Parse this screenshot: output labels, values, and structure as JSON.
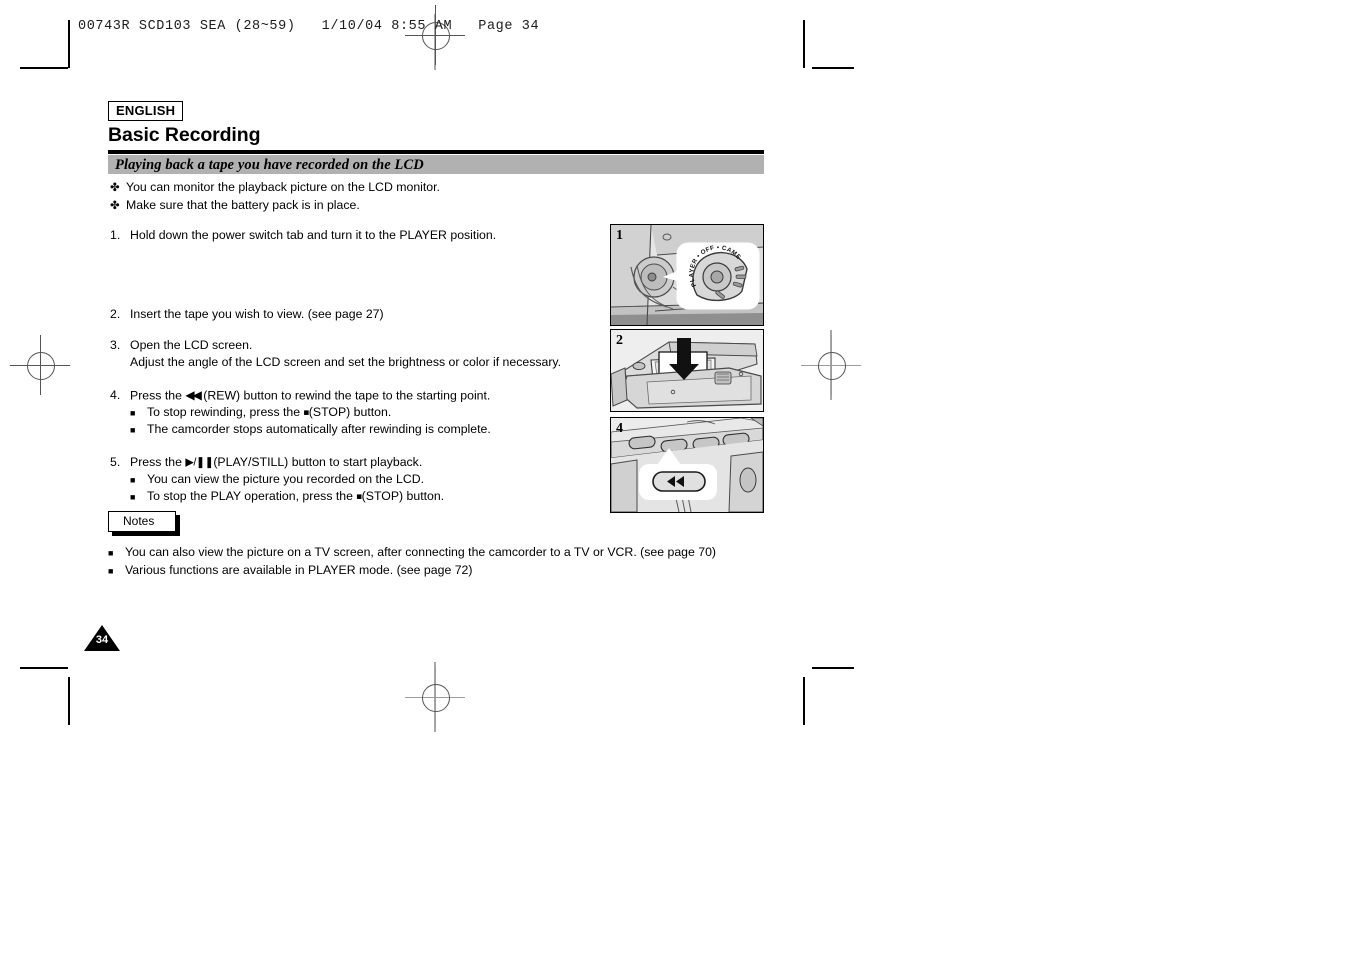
{
  "film_header": {
    "text": "00743R SCD103 SEA (28~59)   1/10/04 8:55 AM   Page 34"
  },
  "page": {
    "language_badge": "ENGLISH",
    "chapter_title": "Basic Recording",
    "section_title": "Playing back a tape you have recorded on the LCD",
    "page_number": "34"
  },
  "intro": {
    "bullet_glyph": "✤",
    "lines": [
      "You can monitor the playback picture on the LCD monitor.",
      "Make sure that the battery pack is in place."
    ]
  },
  "steps": [
    {
      "number": "1.",
      "text": "Hold down the power switch tab and turn it to the PLAYER position.",
      "continuation": "",
      "subs": []
    },
    {
      "number": "2.",
      "text": "Insert the tape you wish to view. (see page 27)",
      "continuation": "",
      "subs": []
    },
    {
      "number": "3.",
      "text": "Open the LCD screen.",
      "continuation": "Adjust the angle of the LCD screen and set the brightness or color if necessary.",
      "subs": []
    },
    {
      "number": "4.",
      "text_before": "Press the",
      "glyph": "◀◀",
      "text_after": "(REW) button to rewind the tape to the starting point.",
      "subs": [
        {
          "before": "To stop rewinding, press the",
          "glyph": "■",
          "after": "(STOP) button."
        },
        {
          "before": "The camcorder stops automatically after rewinding is complete.",
          "glyph": "",
          "after": ""
        }
      ]
    },
    {
      "number": "5.",
      "text_before": "Press the",
      "glyph": "▶/❚❚",
      "text_after": "(PLAY/STILL) button to start playback.",
      "subs": [
        {
          "before": "You can view the picture you recorded on the LCD.",
          "glyph": "",
          "after": ""
        },
        {
          "before": "To stop the PLAY operation, press the",
          "glyph": "■",
          "after": "(STOP) button."
        }
      ]
    }
  ],
  "notes": {
    "label": "Notes",
    "bullet_glyph": "■",
    "items": [
      "You can also view the picture on a TV screen, after connecting the camcorder to a TV or VCR. (see page 70)",
      "Various functions are available in PLAYER mode. (see page 72)"
    ]
  },
  "figures": [
    {
      "badge": "1",
      "caption_labels": [
        "PLAYER",
        "OFF",
        "CAMERA"
      ],
      "description": "power switch dial detail"
    },
    {
      "badge": "2",
      "caption_labels": [],
      "description": "inserting cassette tape with downward arrow"
    },
    {
      "badge": "4",
      "caption_labels": [],
      "description": "REW button callout on camcorder body"
    }
  ],
  "colors": {
    "section_bar": "#b1b1b1",
    "rule": "#000000",
    "panel_bg": "#e9e9e9",
    "ink": "#000000"
  }
}
